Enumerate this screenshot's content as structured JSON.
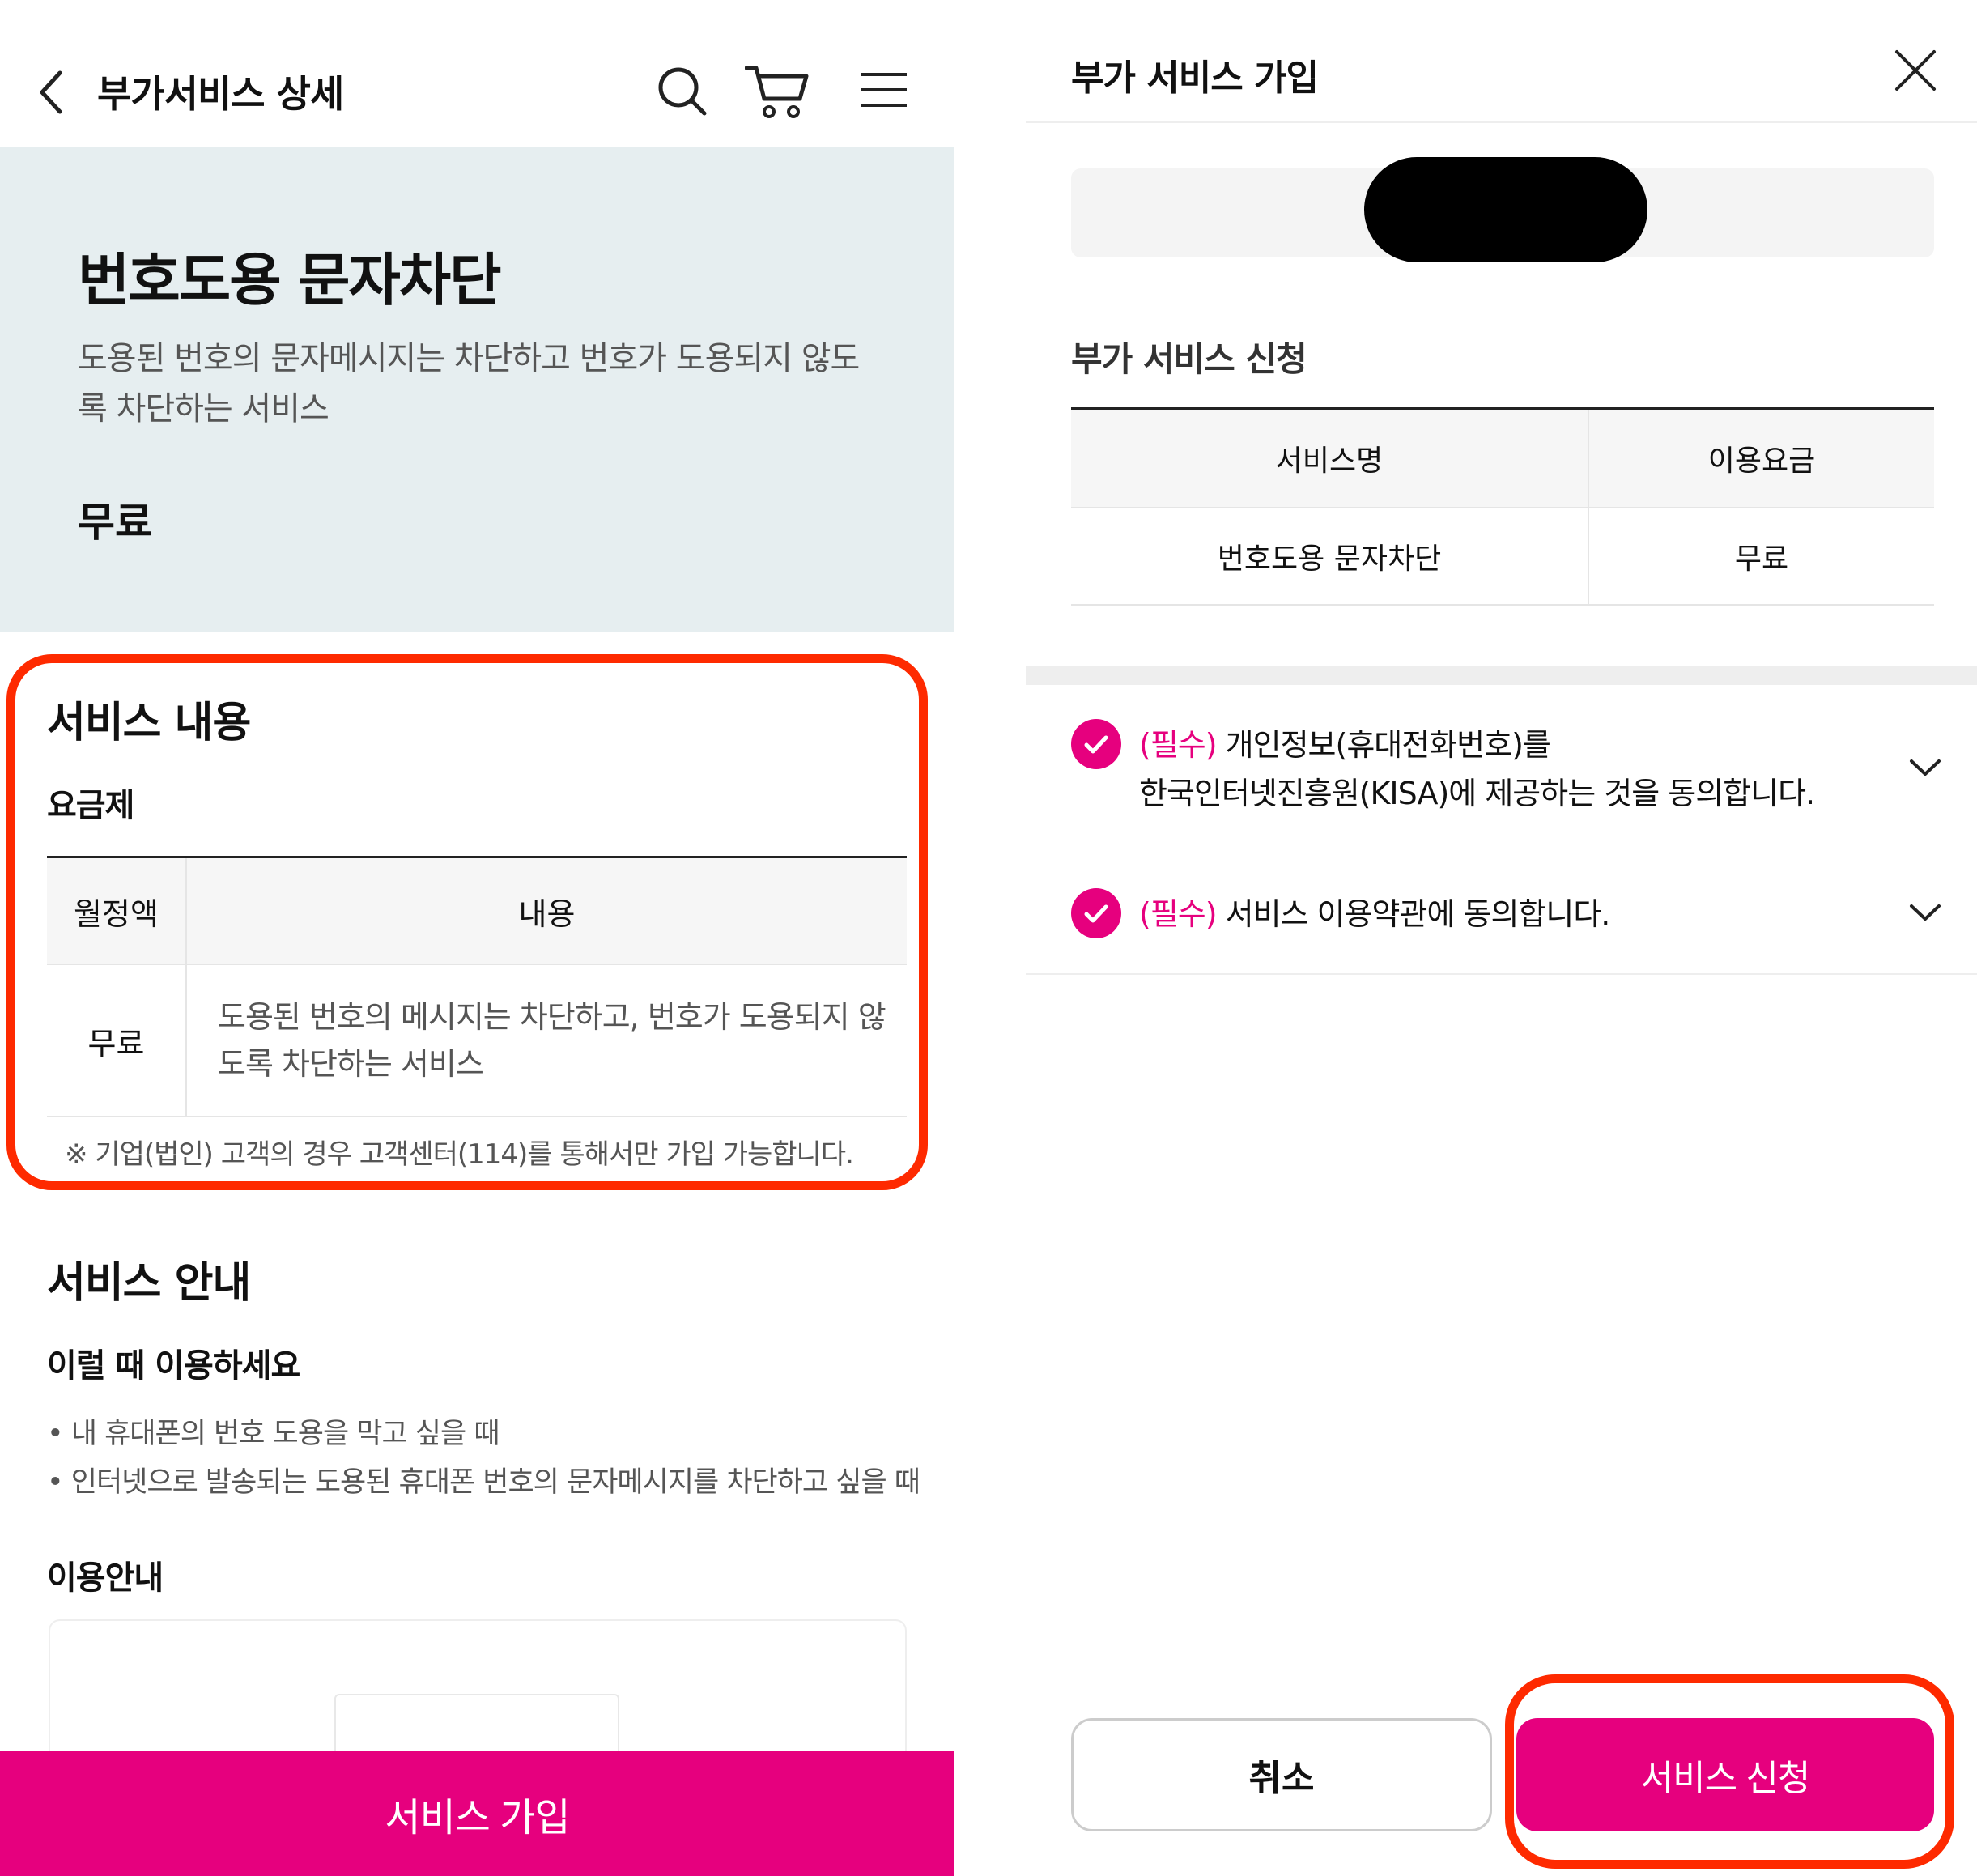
{
  "left": {
    "header": {
      "back_icon": "chevron-left-icon",
      "title": "부가서비스 상세",
      "search_icon": "search-icon",
      "cart_icon": "cart-icon",
      "menu_icon": "menu-icon"
    },
    "hero": {
      "title": "번호도용 문자차단",
      "description": "도용된 번호의 문자메시지는 차단하고 번호가 도용되지 않도록 차단하는 서비스",
      "price": "무료"
    },
    "service_content": {
      "title": "서비스 내용",
      "subtitle": "요금제",
      "table": {
        "headers": [
          "월정액",
          "내용"
        ],
        "rows": [
          {
            "fee": "무료",
            "content": "도용된 번호의 메시지는 차단하고, 번호가 도용되지 않도록 차단하는 서비스"
          }
        ]
      },
      "note": "※ 기업(법인) 고객의 경우 고객센터(114)를 통해서만 가입 가능합니다."
    },
    "service_guide": {
      "title": "서비스 안내",
      "when_title": "이럴 때 이용하세요",
      "bullets": [
        "• 내 휴대폰의 번호 도용을 막고 싶을 때",
        "• 인터넷으로 발송되는 도용된 휴대폰 번호의 문자메시지를 차단하고 싶을 때"
      ],
      "usage_title": "이용안내"
    },
    "join_button": "서비스 가입"
  },
  "right": {
    "title": "부가 서비스 가입",
    "close_icon": "close-icon",
    "section_title": "부가 서비스 신청",
    "table": {
      "headers": [
        "서비스명",
        "이용요금"
      ],
      "rows": [
        {
          "name": "번호도용 문자차단",
          "fee": "무료"
        }
      ]
    },
    "agreements": [
      {
        "tag": "(필수)",
        "text": "개인정보(휴대전화번호)를",
        "text2": "한국인터넷진흥원(KISA)에 제공하는 것을 동의합니다.",
        "checked": true
      },
      {
        "tag": "(필수)",
        "text": "서비스 이용약관에 동의합니다.",
        "checked": true
      }
    ],
    "cancel_button": "취소",
    "apply_button": "서비스 신청"
  },
  "colors": {
    "accent": "#e6007e",
    "highlight": "#fe2a00",
    "hero_bg": "#e6eef0"
  }
}
